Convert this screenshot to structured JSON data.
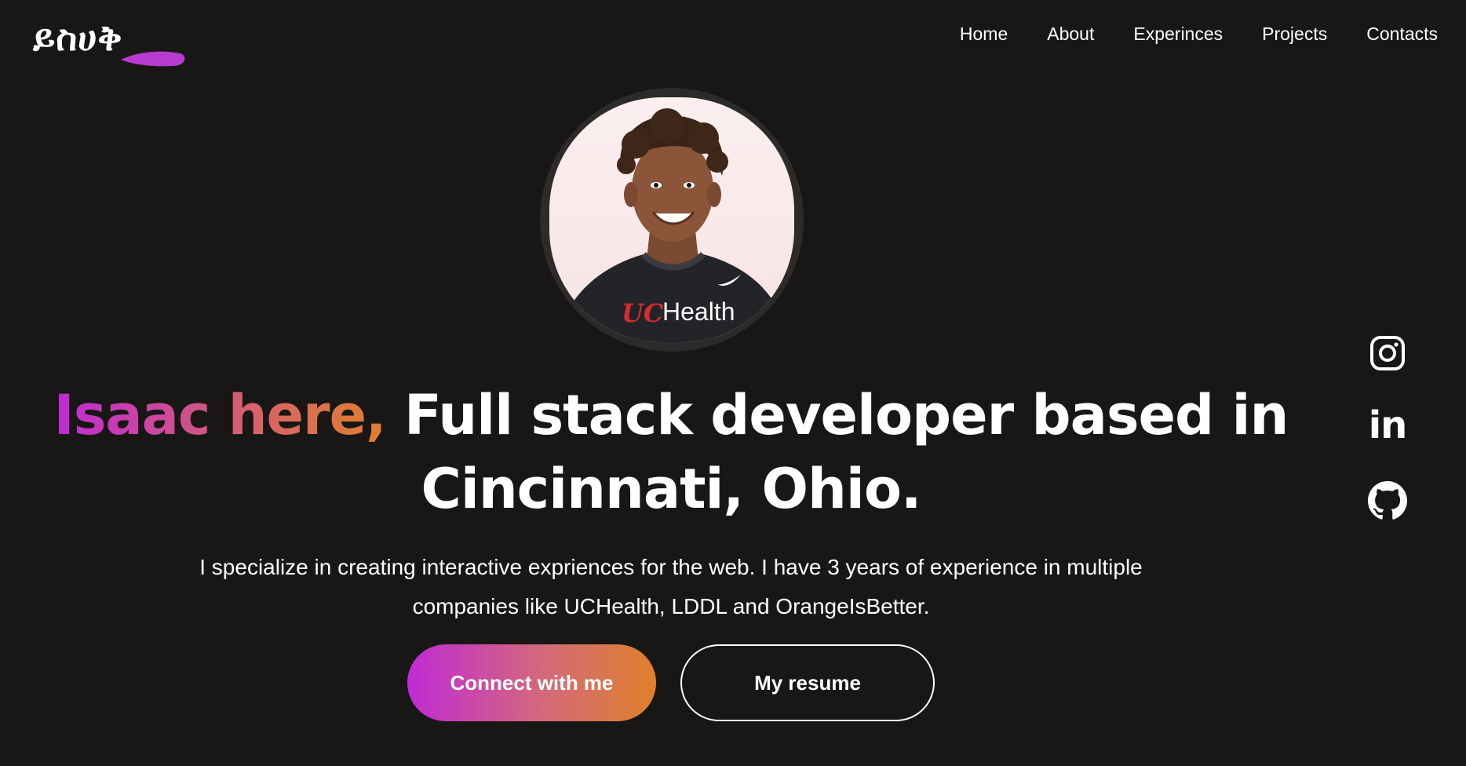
{
  "header": {
    "logo_text": "ይስሀቅ",
    "nav": [
      "Home",
      "About",
      "Experinces",
      "Projects",
      "Contacts"
    ]
  },
  "hero": {
    "avatar_alt": "Profile photo",
    "shirt_text": "Health",
    "shirt_logo": "UC",
    "headline_highlight": "Isaac here,",
    "headline_rest": "Full stack developer based in Cincinnati, Ohio.",
    "description": "I specialize in creating interactive exprience​s for the web. I have 3 years of experience in multiple companies like UCHealth, LDDL and OrangeIsBetter.",
    "primary_button": "Connect with me",
    "secondary_button": "My resume"
  },
  "social": {
    "items": [
      "instagram-icon",
      "linkedin-icon",
      "github-icon"
    ],
    "linkedin_text": "in"
  },
  "colors": {
    "background": "#181716",
    "gradient_start": "#c02ad4",
    "gradient_end": "#e0802a",
    "text": "#ffffff"
  }
}
